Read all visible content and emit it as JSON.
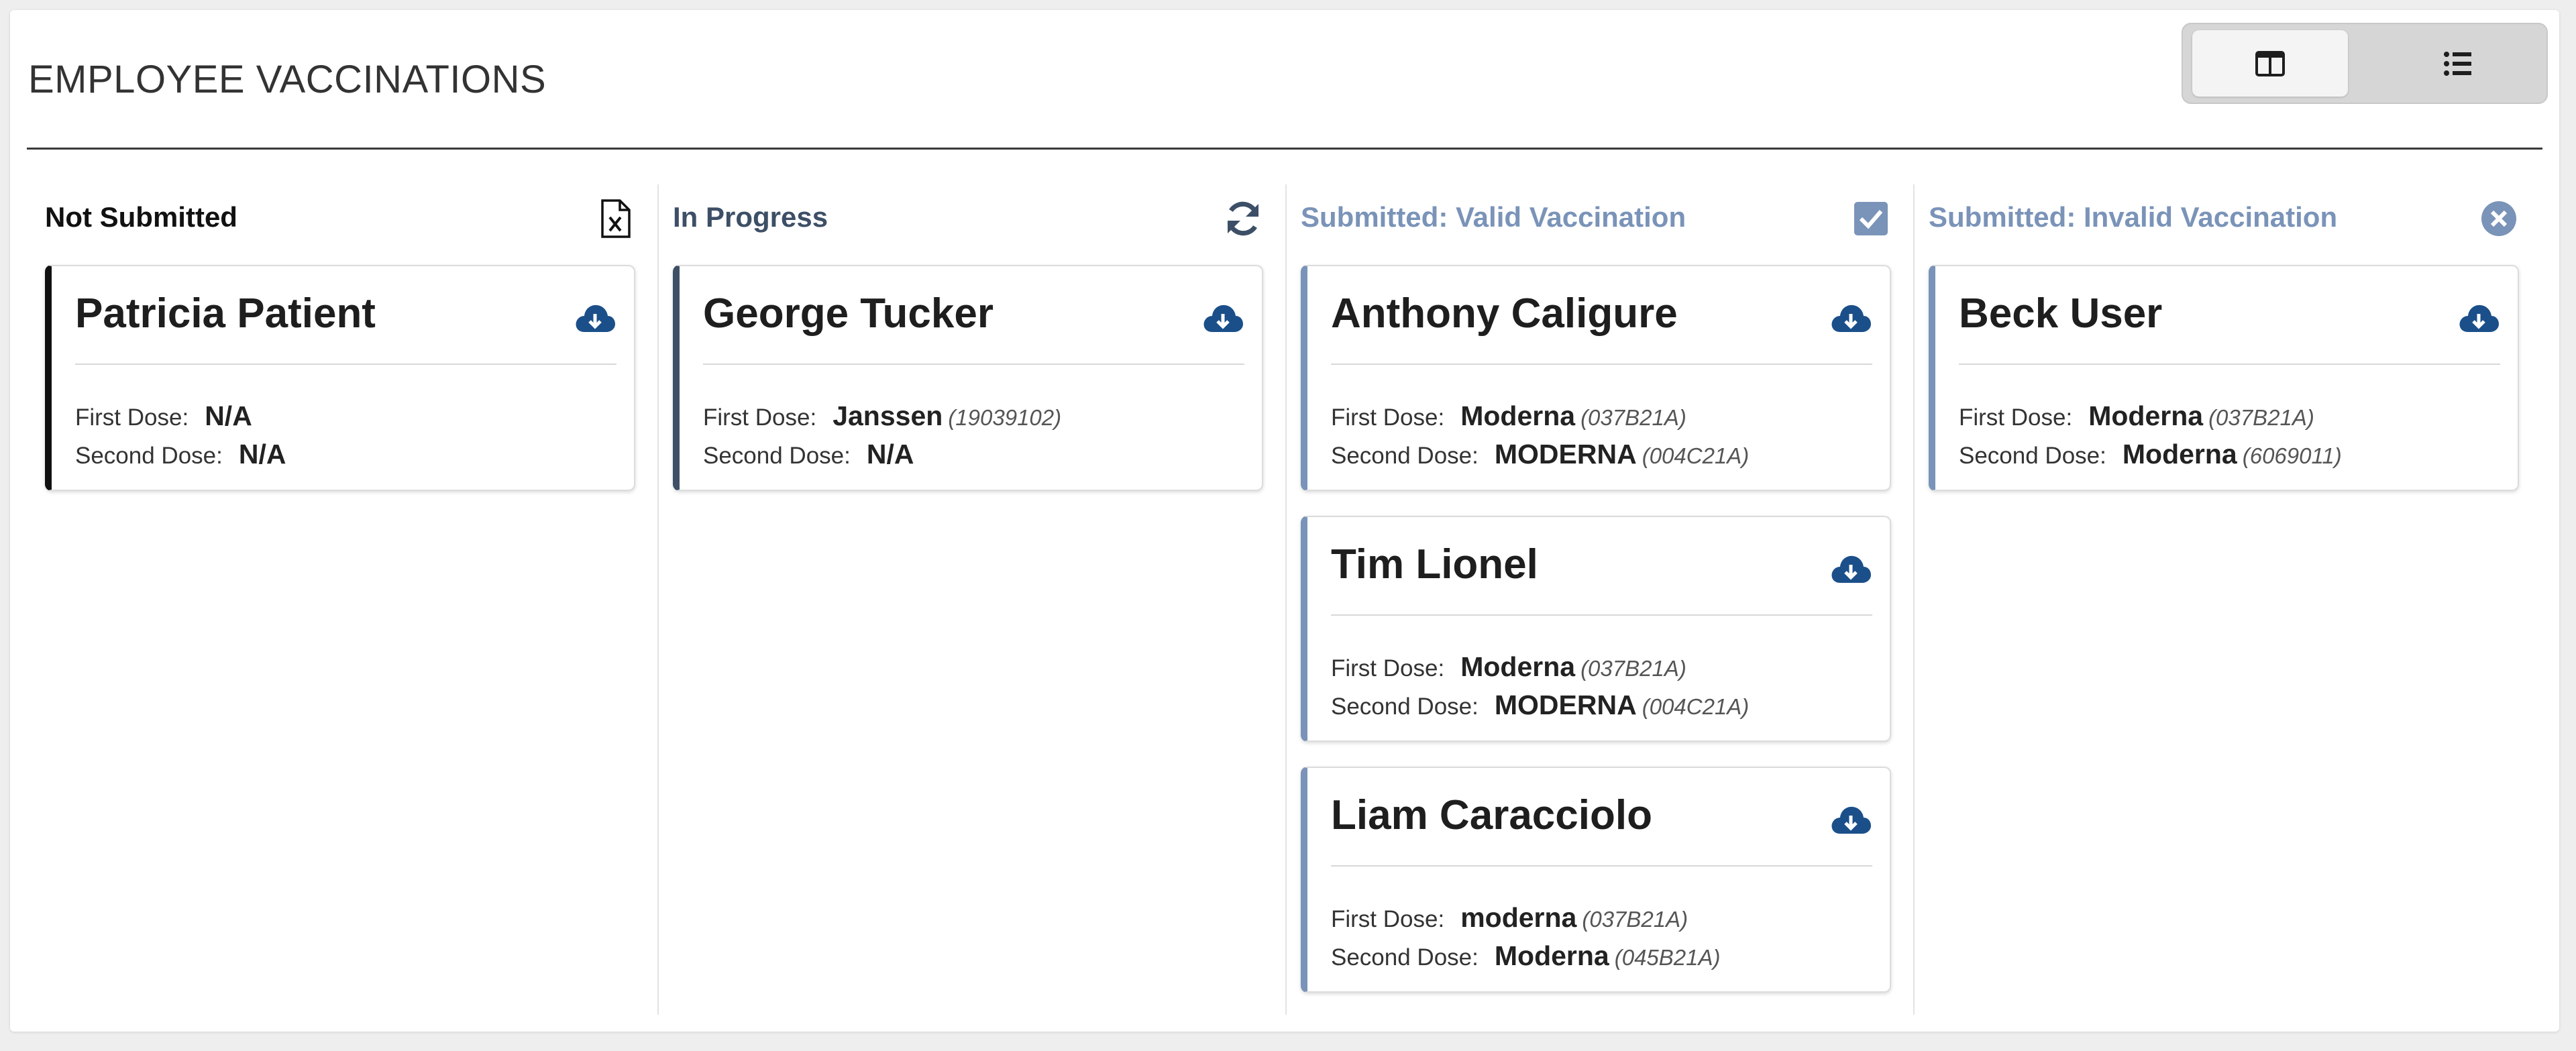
{
  "header": {
    "title": "EMPLOYEE VACCINATIONS",
    "view_toggle": {
      "active": "board-view",
      "options": [
        "board-view-icon",
        "list-view-icon"
      ]
    }
  },
  "colors": {
    "not_submitted": "#111111",
    "in_progress": "#3d4f66",
    "valid": "#7a93b8",
    "invalid": "#7a93b8",
    "accent_blue": "#1b4f8a"
  },
  "columns": [
    {
      "title": "Not Submitted",
      "icon": "file-excel-icon",
      "cards": [
        {
          "name": "Patricia Patient",
          "first_label": "First Dose:",
          "first_vaccine": "N/A",
          "first_lot": "",
          "second_label": "Second Dose:",
          "second_vaccine": "N/A",
          "second_lot": ""
        }
      ]
    },
    {
      "title": "In Progress",
      "icon": "refresh-icon",
      "cards": [
        {
          "name": "George Tucker",
          "first_label": "First Dose:",
          "first_vaccine": "Janssen",
          "first_lot": "(19039102)",
          "second_label": "Second Dose:",
          "second_vaccine": "N/A",
          "second_lot": ""
        }
      ]
    },
    {
      "title": "Submitted: Valid Vaccination",
      "icon": "check-square-icon",
      "cards": [
        {
          "name": "Anthony Caligure",
          "first_label": "First Dose:",
          "first_vaccine": "Moderna",
          "first_lot": "(037B21A)",
          "second_label": "Second Dose:",
          "second_vaccine": "MODERNA",
          "second_lot": "(004C21A)"
        },
        {
          "name": "Tim Lionel",
          "first_label": "First Dose:",
          "first_vaccine": "Moderna",
          "first_lot": "(037B21A)",
          "second_label": "Second Dose:",
          "second_vaccine": "MODERNA",
          "second_lot": "(004C21A)"
        },
        {
          "name": "Liam Caracciolo",
          "first_label": "First Dose:",
          "first_vaccine": "moderna",
          "first_lot": "(037B21A)",
          "second_label": "Second Dose:",
          "second_vaccine": "Moderna",
          "second_lot": "(045B21A)"
        }
      ]
    },
    {
      "title": "Submitted: Invalid Vaccination",
      "icon": "times-circle-icon",
      "cards": [
        {
          "name": "Beck User",
          "first_label": "First Dose:",
          "first_vaccine": "Moderna",
          "first_lot": "(037B21A)",
          "second_label": "Second Dose:",
          "second_vaccine": "Moderna",
          "second_lot": "(6069011)"
        }
      ]
    }
  ]
}
